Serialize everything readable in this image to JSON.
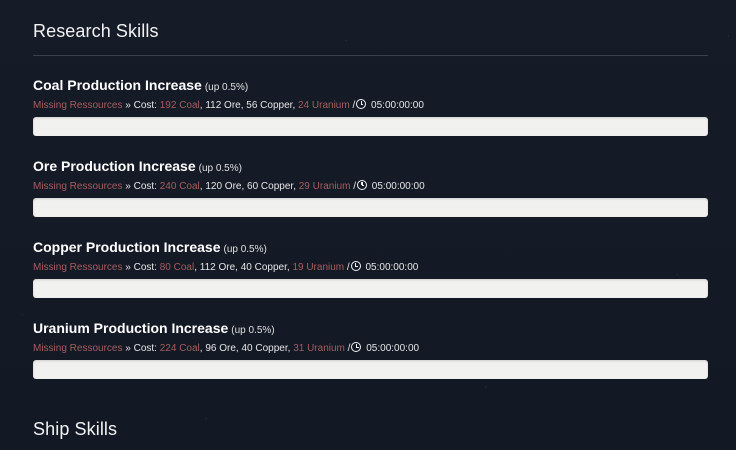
{
  "research": {
    "title": "Research Skills",
    "skills": [
      {
        "name": "Coal Production Increase",
        "bonus": "(up 0.5%)",
        "missing_label": "Missing Ressources",
        "cost_prefix": "» Cost:",
        "coal": "192 Coal",
        "ore": "112 Ore",
        "copper": "56 Copper",
        "uranium": "24 Uranium",
        "time": "05:00:00:00",
        "progress": 0
      },
      {
        "name": "Ore Production Increase",
        "bonus": "(up 0.5%)",
        "missing_label": "Missing Ressources",
        "cost_prefix": "» Cost:",
        "coal": "240 Coal",
        "ore": "120 Ore",
        "copper": "60 Copper",
        "uranium": "29 Uranium",
        "time": "05:00:00:00",
        "progress": 0
      },
      {
        "name": "Copper Production Increase",
        "bonus": "(up 0.5%)",
        "missing_label": "Missing Ressources",
        "cost_prefix": "» Cost:",
        "coal": "80 Coal",
        "ore": "112 Ore",
        "copper": "40 Copper",
        "uranium": "19 Uranium",
        "time": "05:00:00:00",
        "progress": 0
      },
      {
        "name": "Uranium Production Increase",
        "bonus": "(up 0.5%)",
        "missing_label": "Missing Ressources",
        "cost_prefix": "» Cost:",
        "coal": "224 Coal",
        "ore": "96 Ore",
        "copper": "40 Copper",
        "uranium": "31 Uranium",
        "time": "05:00:00:00",
        "progress": 0
      }
    ]
  },
  "ship": {
    "title": "Ship Skills"
  },
  "colors": {
    "missing": "#a85d5d",
    "background": "#141a25",
    "bar": "#f1f1ef"
  }
}
